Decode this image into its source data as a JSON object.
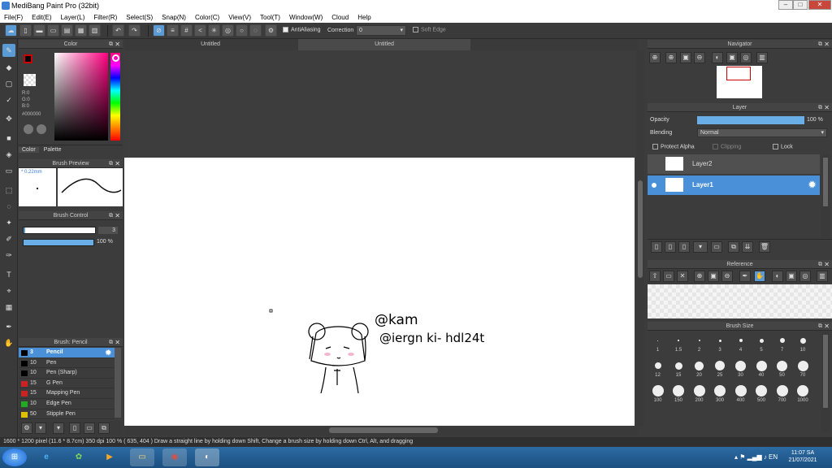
{
  "app": {
    "title": "MediBang Paint Pro (32bit)"
  },
  "window_controls": [
    "–",
    "□",
    "✕"
  ],
  "menu": [
    "File(F)",
    "Edit(E)",
    "Layer(L)",
    "Filter(R)",
    "Select(S)",
    "Snap(N)",
    "Color(C)",
    "View(V)",
    "Tool(T)",
    "Window(W)",
    "Cloud",
    "Help"
  ],
  "toolbar": {
    "antialiasing_label": "AntiAliasing",
    "correction_label": "Correction",
    "correction_value": "0",
    "soft_edge_label": "Soft Edge"
  },
  "tabs": [
    "Untitled",
    "Untitled"
  ],
  "color_panel": {
    "title": "Color",
    "rgb_r": "R:0",
    "rgb_g": "G:0",
    "rgb_b": "B:0",
    "hex": "#000000",
    "tab_color": "Color",
    "tab_palette": "Palette",
    "fg": "#000000",
    "bg_accent": "#cc0000"
  },
  "brush_preview": {
    "title": "Brush Preview",
    "size_label": "* 0.22mm"
  },
  "brush_control": {
    "title": "Brush Control",
    "size_value": "3",
    "opacity_label": "100 %",
    "opacity": 100
  },
  "brush_list": {
    "title": "Brush: Pencil",
    "items": [
      {
        "size": "3",
        "name": "Pencil",
        "color": "#000000",
        "selected": true
      },
      {
        "size": "10",
        "name": "Pen",
        "color": "#000000"
      },
      {
        "size": "10",
        "name": "Pen (Sharp)",
        "color": "#000000"
      },
      {
        "size": "15",
        "name": "G Pen",
        "color": "#cc2222"
      },
      {
        "size": "15",
        "name": "Mapping Pen",
        "color": "#cc2222"
      },
      {
        "size": "10",
        "name": "Edge Pen",
        "color": "#22aa22"
      },
      {
        "size": "50",
        "name": "Stipple Pen",
        "color": "#e0c000"
      }
    ]
  },
  "canvas_text": {
    "line1": "@kam",
    "line2": "@iergn ki- hdl24t"
  },
  "navigator": {
    "title": "Navigator"
  },
  "layer_panel": {
    "title": "Layer",
    "opacity_label": "Opacity",
    "opacity_value": "100 %",
    "opacity": 100,
    "blending_label": "Blending",
    "blending_value": "Normal",
    "protect_alpha": "Protect Alpha",
    "clipping": "Clipping",
    "lock": "Lock",
    "layers": [
      {
        "name": "Layer2",
        "selected": false
      },
      {
        "name": "Layer1",
        "selected": true
      }
    ]
  },
  "reference": {
    "title": "Reference"
  },
  "brush_size": {
    "title": "Brush Size",
    "row1": [
      "1",
      "1.5",
      "2",
      "3",
      "4",
      "5",
      "7",
      "10"
    ],
    "row2": [
      "12",
      "15",
      "20",
      "25",
      "30",
      "40",
      "50",
      "70"
    ],
    "row3": [
      "100",
      "150",
      "200",
      "300",
      "400",
      "500",
      "700",
      "1000"
    ]
  },
  "status": "1600 * 1200 pixel   (11.6 * 8.7cm)  350 dpi   100 %   ( 635, 404 )   Draw a straight line by holding down Shift, Change a brush size by holding down Ctrl, Alt, and dragging",
  "taskbar": {
    "time": "11:07 SA",
    "date": "21/07/2021"
  }
}
